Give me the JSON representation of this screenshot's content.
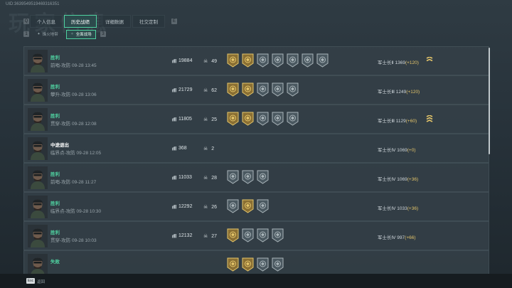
{
  "uid": "UID:3639549519469316351",
  "background_title": "玩家信息",
  "tabs": {
    "left_key": "Q",
    "right_key": "E",
    "items": [
      {
        "label": "个人信息",
        "active": false
      },
      {
        "label": "历史战绩",
        "active": true
      },
      {
        "label": "详细数据",
        "active": false
      },
      {
        "label": "社交定制",
        "active": false
      }
    ]
  },
  "subtabs": {
    "left_key": "1",
    "right_key": "3",
    "items": [
      {
        "label": "烽火地带",
        "active": false
      },
      {
        "label": "全面战场",
        "active": true
      }
    ]
  },
  "colors": {
    "accent": "#4fd1a0",
    "gold": "#e4c56a",
    "row_bg": "#34404a"
  },
  "matches": [
    {
      "result": "胜利",
      "result_type": "win",
      "map_time": "前哨-攻防 09-28 13:45",
      "score": "19884",
      "kills": "49",
      "medals": [
        "gold",
        "gold",
        "silver",
        "silver",
        "silver",
        "silver",
        "silver"
      ],
      "rank": "军士长Ⅱ 1369",
      "delta": "(+120)",
      "rank_icon": "double-chevron"
    },
    {
      "result": "胜利",
      "result_type": "win",
      "map_time": "攀升-攻防 09-28 13:06",
      "score": "21729",
      "kills": "62",
      "medals": [
        "gold",
        "gold",
        "silver",
        "silver",
        "silver"
      ],
      "rank": "军士长Ⅲ 1249",
      "delta": "(+120)",
      "rank_icon": ""
    },
    {
      "result": "胜利",
      "result_type": "win",
      "map_time": "贯穿-攻防 09-28 12:08",
      "score": "11805",
      "kills": "25",
      "medals": [
        "gold",
        "gold",
        "silver",
        "silver",
        "silver"
      ],
      "rank": "军士长Ⅲ 1129",
      "delta": "(+60)",
      "rank_icon": "triple-chevron"
    },
    {
      "result": "中途退出",
      "result_type": "other",
      "map_time": "临界点-攻防 09-28 12:05",
      "score": "368",
      "kills": "2",
      "medals": [],
      "rank": "军士长Ⅳ 1069",
      "delta": "(+0)",
      "rank_icon": ""
    },
    {
      "result": "胜利",
      "result_type": "win",
      "map_time": "前哨-攻防 09-28 11:27",
      "score": "11033",
      "kills": "28",
      "medals": [
        "silver",
        "silver",
        "silver"
      ],
      "rank": "军士长Ⅳ 1069",
      "delta": "(+36)",
      "rank_icon": ""
    },
    {
      "result": "胜利",
      "result_type": "win",
      "map_time": "临界点-攻防 09-28 10:30",
      "score": "12292",
      "kills": "26",
      "medals": [
        "silver",
        "gold",
        "silver"
      ],
      "rank": "军士长Ⅳ 1033",
      "delta": "(+36)",
      "rank_icon": ""
    },
    {
      "result": "胜利",
      "result_type": "win",
      "map_time": "贯穿-攻防 09-28 10:03",
      "score": "12132",
      "kills": "27",
      "medals": [
        "gold",
        "silver",
        "silver",
        "silver"
      ],
      "rank": "军士长Ⅳ 997",
      "delta": "(+66)",
      "rank_icon": ""
    },
    {
      "result": "失败",
      "result_type": "win",
      "map_time": "",
      "score": "",
      "kills": "",
      "medals": [
        "gold",
        "gold",
        "silver",
        "silver"
      ],
      "rank": "",
      "delta": "",
      "rank_icon": ""
    }
  ],
  "footer": {
    "esc_key": "Esc",
    "back_label": "返回"
  }
}
